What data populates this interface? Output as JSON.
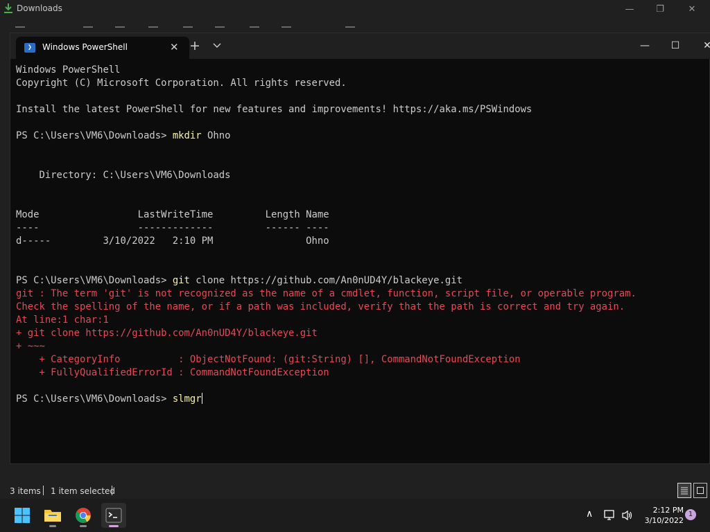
{
  "explorer": {
    "title": "Downloads",
    "status_items": "3 items",
    "status_selected": "1 item selected"
  },
  "terminal": {
    "tab_title": "Windows PowerShell",
    "lines": [
      {
        "text": "Windows PowerShell",
        "kind": "out"
      },
      {
        "text": "Copyright (C) Microsoft Corporation. All rights reserved.",
        "kind": "out"
      },
      {
        "text": "",
        "kind": "out"
      },
      {
        "text": "Install the latest PowerShell for new features and improvements! https://aka.ms/PSWindows",
        "kind": "out"
      },
      {
        "text": "",
        "kind": "out"
      },
      {
        "prompt": "PS C:\\Users\\VM6\\Downloads> ",
        "cmd": "mkdir",
        "args": " Ohno",
        "kind": "prompt"
      },
      {
        "text": "",
        "kind": "out"
      },
      {
        "text": "",
        "kind": "out"
      },
      {
        "text": "    Directory: C:\\Users\\VM6\\Downloads",
        "kind": "out"
      },
      {
        "text": "",
        "kind": "out"
      },
      {
        "text": "",
        "kind": "out"
      },
      {
        "text": "Mode                 LastWriteTime         Length Name",
        "kind": "out"
      },
      {
        "text": "----                 -------------         ------ ----",
        "kind": "out"
      },
      {
        "text": "d-----         3/10/2022   2:10 PM                Ohno",
        "kind": "out"
      },
      {
        "text": "",
        "kind": "out"
      },
      {
        "text": "",
        "kind": "out"
      },
      {
        "prompt": "PS C:\\Users\\VM6\\Downloads> ",
        "cmd": "git",
        "args": " clone https://github.com/An0nUD4Y/blackeye.git",
        "kind": "prompt"
      },
      {
        "text": "git : The term 'git' is not recognized as the name of a cmdlet, function, script file, or operable program.",
        "kind": "err"
      },
      {
        "text": "Check the spelling of the name, or if a path was included, verify that the path is correct and try again.",
        "kind": "err"
      },
      {
        "text": "At line:1 char:1",
        "kind": "err"
      },
      {
        "text": "+ git clone https://github.com/An0nUD4Y/blackeye.git",
        "kind": "err"
      },
      {
        "text": "+ ~~~",
        "kind": "err"
      },
      {
        "text": "    + CategoryInfo          : ObjectNotFound: (git:String) [], CommandNotFoundException",
        "kind": "err"
      },
      {
        "text": "    + FullyQualifiedErrorId : CommandNotFoundException",
        "kind": "err"
      },
      {
        "text": "",
        "kind": "out"
      },
      {
        "prompt": "PS C:\\Users\\VM6\\Downloads> ",
        "cmd": "slmgr",
        "args": "",
        "kind": "prompt",
        "cursor": true
      }
    ]
  },
  "taskbar": {
    "time": "2:12 PM",
    "date": "3/10/2022",
    "notification_count": "1",
    "apps": [
      "start-icon",
      "file-explorer-icon",
      "chrome-icon",
      "terminal-icon"
    ]
  },
  "colors": {
    "terminal_bg": "#0c0c0c",
    "command": "#f9f1a5",
    "error": "#e74856",
    "accent": "#d6a2de"
  }
}
